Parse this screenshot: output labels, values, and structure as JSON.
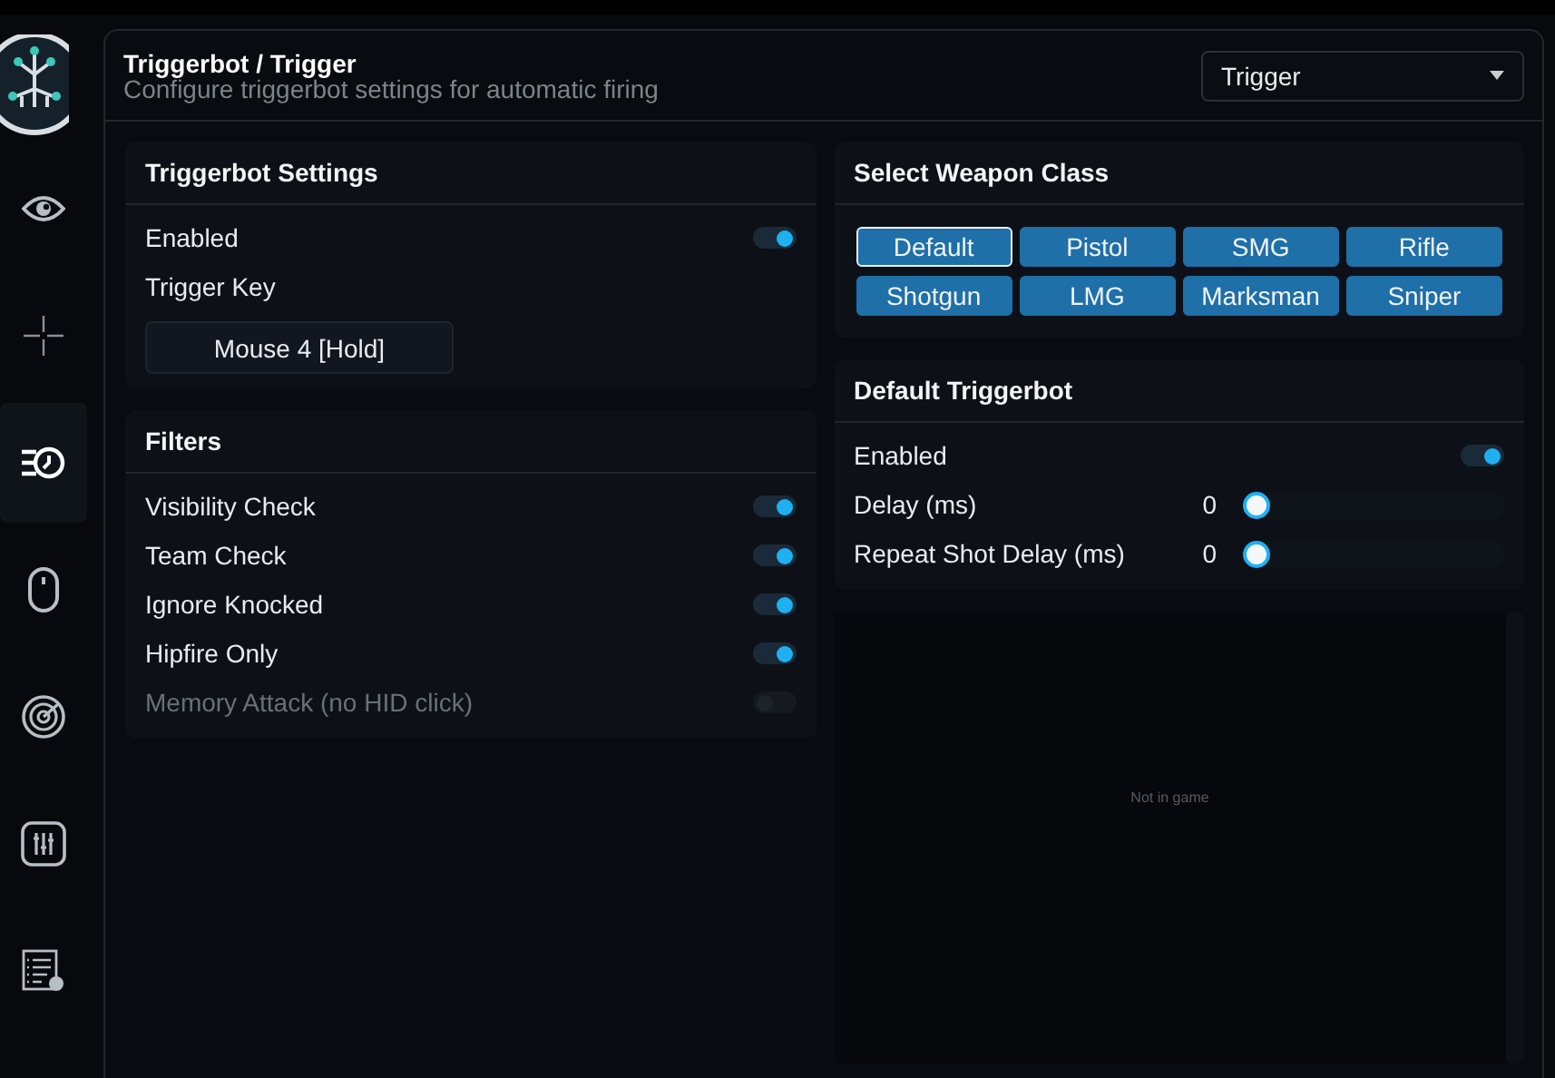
{
  "sidebar": {
    "items": [
      {
        "selected": false
      },
      {
        "selected": false
      },
      {
        "selected": true
      },
      {
        "selected": false
      },
      {
        "selected": false
      },
      {
        "selected": false
      },
      {
        "selected": false
      }
    ]
  },
  "header": {
    "title": "Triggerbot / Trigger",
    "subtitle": "Configure triggerbot settings for automatic firing",
    "dropdown": "Trigger"
  },
  "triggerbot_settings": {
    "title": "Triggerbot Settings",
    "enabled": {
      "label": "Enabled",
      "on": true
    },
    "trigger_key": {
      "label": "Trigger Key",
      "value": "Mouse 4 [Hold]"
    }
  },
  "filters": {
    "title": "Filters",
    "items": [
      {
        "label": "Visibility Check",
        "on": true,
        "disabled": false
      },
      {
        "label": "Team Check",
        "on": true,
        "disabled": false
      },
      {
        "label": "Ignore Knocked",
        "on": true,
        "disabled": false
      },
      {
        "label": "Hipfire Only",
        "on": true,
        "disabled": false
      },
      {
        "label": "Memory Attack (no HID click)",
        "on": false,
        "disabled": true
      }
    ]
  },
  "weapon_class": {
    "title": "Select Weapon Class",
    "options": [
      {
        "label": "Default",
        "selected": true
      },
      {
        "label": "Pistol",
        "selected": false
      },
      {
        "label": "SMG",
        "selected": false
      },
      {
        "label": "Rifle",
        "selected": false
      },
      {
        "label": "Shotgun",
        "selected": false
      },
      {
        "label": "LMG",
        "selected": false
      },
      {
        "label": "Marksman",
        "selected": false
      },
      {
        "label": "Sniper",
        "selected": false
      }
    ]
  },
  "default_triggerbot": {
    "title": "Default Triggerbot",
    "rows": [
      {
        "kind": "toggle",
        "label": "Enabled",
        "on": true
      },
      {
        "kind": "slider",
        "label": "Delay (ms)",
        "reading": "0",
        "level": 0
      },
      {
        "kind": "slider",
        "label": "Repeat Shot Delay (ms)",
        "reading": "0",
        "level": 0
      }
    ]
  },
  "preview": {
    "status": "Not in game"
  }
}
